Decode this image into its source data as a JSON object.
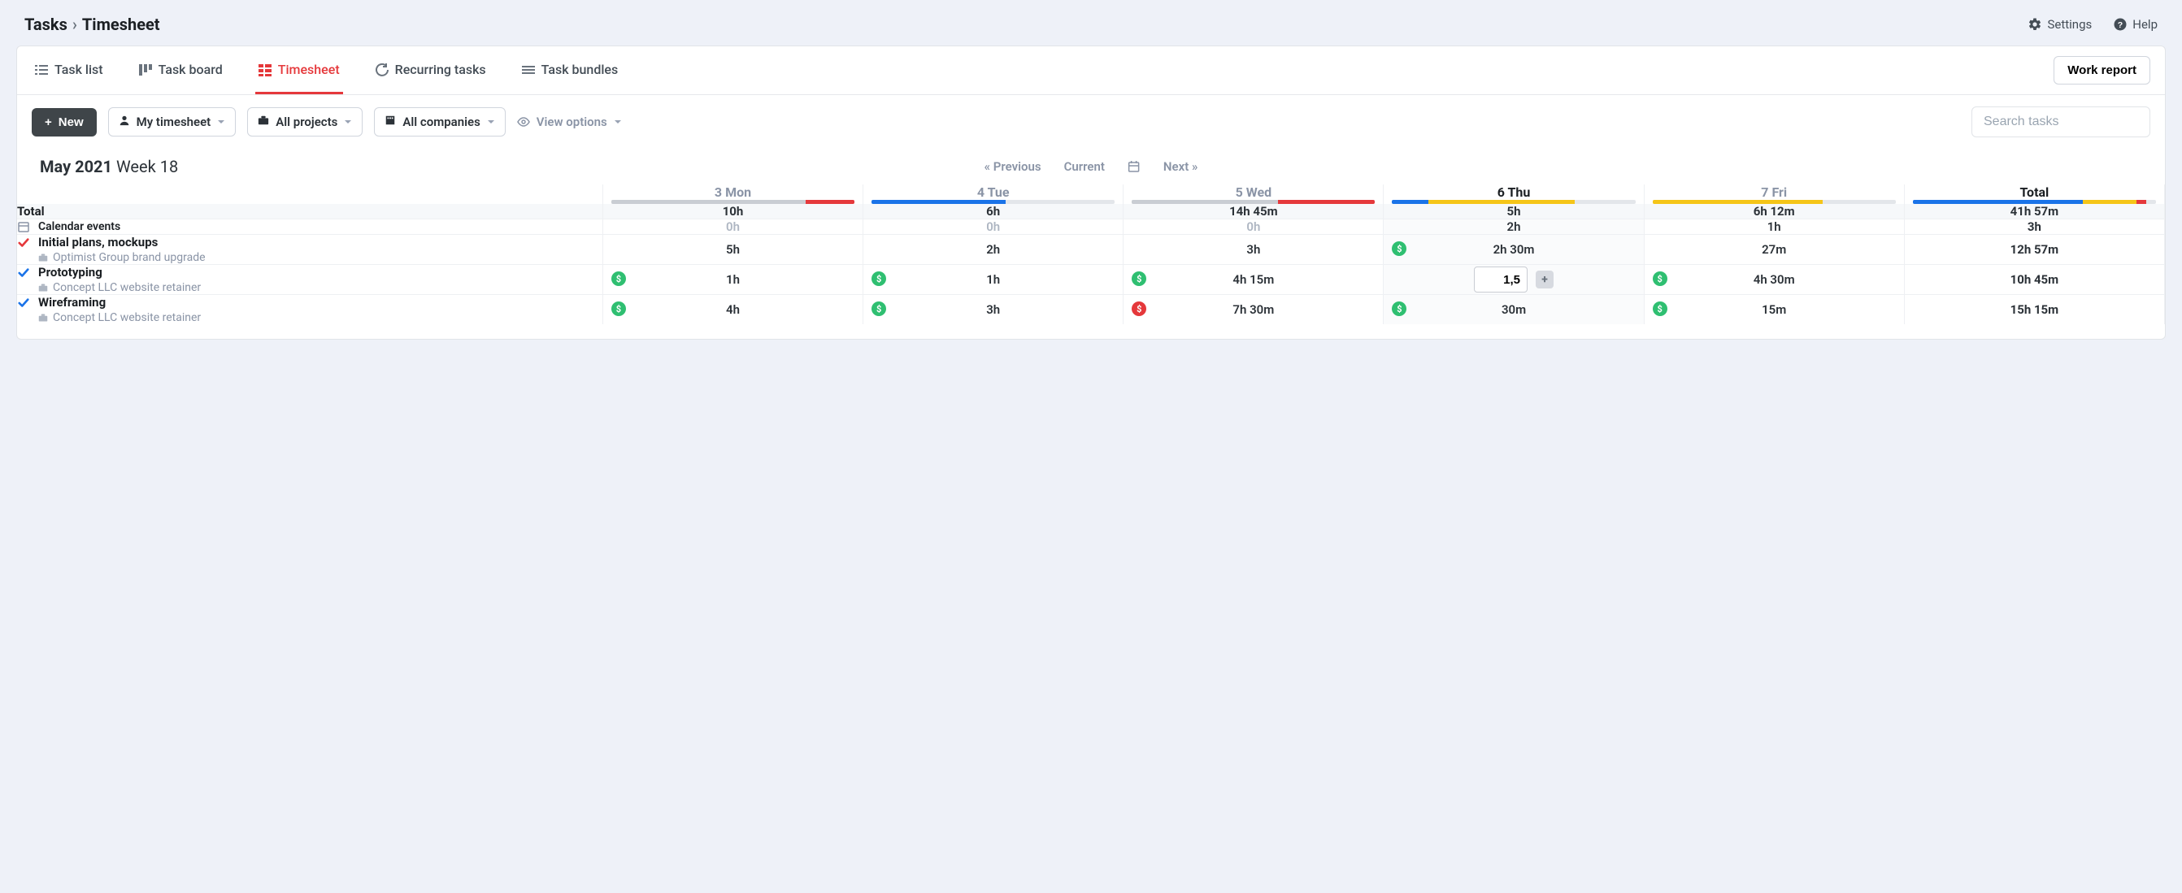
{
  "breadcrumb": {
    "root": "Tasks",
    "current": "Timesheet"
  },
  "topbar": {
    "settings": "Settings",
    "help": "Help"
  },
  "tabs": {
    "list": "Task list",
    "board": "Task board",
    "timesheet": "Timesheet",
    "recurring": "Recurring tasks",
    "bundles": "Task bundles",
    "work_report": "Work report"
  },
  "toolbar": {
    "new": "New",
    "my_timesheet": "My timesheet",
    "all_projects": "All projects",
    "all_companies": "All companies",
    "view_options": "View options",
    "search_placeholder": "Search tasks"
  },
  "period": {
    "month": "May 2021",
    "week": "Week 18",
    "prev": "« Previous",
    "current": "Current",
    "next": "Next »"
  },
  "days": [
    {
      "label": "3 Mon",
      "active": false,
      "bar": [
        {
          "c": "gray",
          "w": 80
        },
        {
          "c": "red",
          "w": 20
        }
      ]
    },
    {
      "label": "4 Tue",
      "active": false,
      "bar": [
        {
          "c": "blue",
          "w": 55
        }
      ]
    },
    {
      "label": "5 Wed",
      "active": false,
      "bar": [
        {
          "c": "gray",
          "w": 60
        },
        {
          "c": "red",
          "w": 40
        }
      ]
    },
    {
      "label": "6 Thu",
      "active": true,
      "bar": [
        {
          "c": "blue",
          "w": 15
        },
        {
          "c": "yellow",
          "w": 60
        }
      ]
    },
    {
      "label": "7 Fri",
      "active": false,
      "bar": [
        {
          "c": "yellow",
          "w": 70
        }
      ]
    }
  ],
  "total_col_label": "Total",
  "total_bar": [
    {
      "c": "blue",
      "w": 70
    },
    {
      "c": "yellow",
      "w": 22
    },
    {
      "c": "red",
      "w": 4
    }
  ],
  "totals_row": {
    "label": "Total",
    "values": [
      "10h",
      "6h",
      "14h 45m",
      "5h",
      "6h 12m"
    ],
    "total": "41h 57m"
  },
  "calendar_row": {
    "label": "Calendar events",
    "values": [
      "0h",
      "0h",
      "0h",
      "2h",
      "1h"
    ],
    "muted": [
      true,
      true,
      true,
      false,
      false
    ],
    "total": "3h"
  },
  "task_rows": [
    {
      "check_color": "#e5383b",
      "title": "Initial plans, mockups",
      "project": "Optimist Group brand upgrade",
      "cells": [
        {
          "value": "5h"
        },
        {
          "value": "2h"
        },
        {
          "value": "3h"
        },
        {
          "value": "2h 30m",
          "dollar": "green"
        },
        {
          "value": "27m"
        }
      ],
      "total": "12h 57m"
    },
    {
      "check_color": "#1a73e8",
      "title": "Prototyping",
      "project": "Concept LLC website retainer",
      "cells": [
        {
          "value": "1h",
          "dollar": "green"
        },
        {
          "value": "1h",
          "dollar": "green"
        },
        {
          "value": "4h 15m",
          "dollar": "green"
        },
        {
          "input": "1,5",
          "editing": true
        },
        {
          "value": "4h 30m",
          "dollar": "green"
        }
      ],
      "total": "10h 45m"
    },
    {
      "check_color": "#1a73e8",
      "title": "Wireframing",
      "project": "Concept LLC website retainer",
      "cells": [
        {
          "value": "4h",
          "dollar": "green"
        },
        {
          "value": "3h",
          "dollar": "green"
        },
        {
          "value": "7h 30m",
          "dollar": "red"
        },
        {
          "value": "30m",
          "dollar": "green"
        },
        {
          "value": "15m",
          "dollar": "green"
        }
      ],
      "total": "15h 15m"
    }
  ]
}
